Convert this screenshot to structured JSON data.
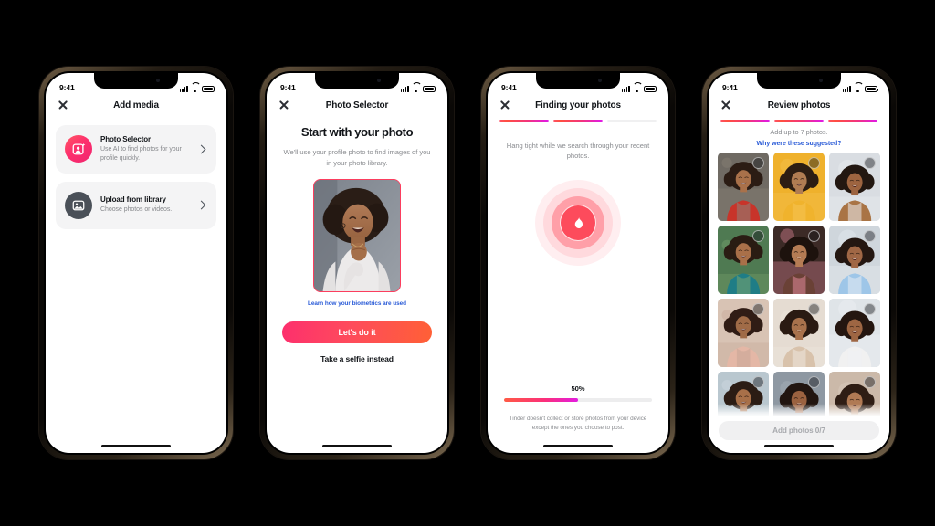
{
  "meta": {
    "background": "#000000",
    "accent_pink": "#fd2f6d",
    "accent_orange": "#ff6036",
    "accent_magenta": "#e018e8",
    "link_blue": "#2a5bd7"
  },
  "status_bar": {
    "time": "9:41",
    "signal_icon": "cellular-bars-icon",
    "wifi_icon": "wifi-icon",
    "battery_icon": "battery-icon"
  },
  "screens": [
    {
      "id": "add-media",
      "nav": {
        "close_icon": "close-icon",
        "title": "Add media"
      },
      "cards": [
        {
          "icon": "photo-selector-icon",
          "title": "Photo Selector",
          "subtitle": "Use AI to find photos for your profile quickly.",
          "chevron": "chevron-right-icon"
        },
        {
          "icon": "image-library-icon",
          "title": "Upload from library",
          "subtitle": "Choose photos or videos.",
          "chevron": "chevron-right-icon"
        }
      ]
    },
    {
      "id": "photo-selector",
      "nav": {
        "close_icon": "close-icon",
        "title": "Photo Selector"
      },
      "heading": "Start with your photo",
      "subtitle": "We'll use your profile photo to find images of you in your photo library.",
      "photo_alt": "profile-photo-preview",
      "link": "Learn how your biometrics are used",
      "primary_button": "Let's do it",
      "secondary_button": "Take a selfie instead"
    },
    {
      "id": "finding-your-photos",
      "nav": {
        "close_icon": "close-icon",
        "title": "Finding your photos"
      },
      "progress_segments": [
        true,
        true,
        false
      ],
      "subtitle": "Hang tight while we search through your recent photos.",
      "loader_icon": "tinder-flame-icon",
      "percent_label": "50%",
      "percent_value": 50,
      "disclaimer": "Tinder doesn't collect or store photos from your device except the ones you choose to post."
    },
    {
      "id": "review-photos",
      "nav": {
        "close_icon": "close-icon",
        "title": "Review photos"
      },
      "progress_segments": [
        true,
        true,
        true
      ],
      "info": "Add up to 7 photos.",
      "link": "Why were these suggested?",
      "button": "Add photos 0/7",
      "selected_count": 0,
      "max_photos": 7,
      "tiles": [
        {
          "name": "photo-tile-1",
          "checkbox": "selection-circle"
        },
        {
          "name": "photo-tile-2",
          "checkbox": "selection-circle"
        },
        {
          "name": "photo-tile-3",
          "checkbox": "selection-circle"
        },
        {
          "name": "photo-tile-4",
          "checkbox": "selection-circle"
        },
        {
          "name": "photo-tile-5",
          "checkbox": "selection-circle"
        },
        {
          "name": "photo-tile-6",
          "checkbox": "selection-circle"
        },
        {
          "name": "photo-tile-7",
          "checkbox": "selection-circle"
        },
        {
          "name": "photo-tile-8",
          "checkbox": "selection-circle"
        },
        {
          "name": "photo-tile-9",
          "checkbox": "selection-circle"
        },
        {
          "name": "photo-tile-10",
          "checkbox": "selection-circle"
        },
        {
          "name": "photo-tile-11",
          "checkbox": "selection-circle"
        },
        {
          "name": "photo-tile-12",
          "checkbox": "selection-circle"
        }
      ]
    }
  ]
}
